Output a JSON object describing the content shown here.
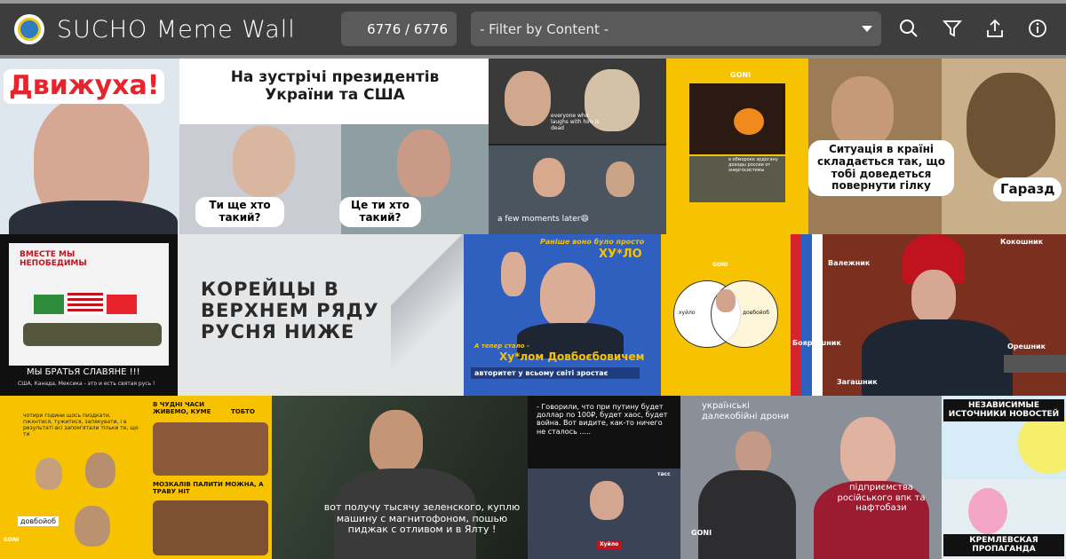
{
  "app": {
    "title": "SUCHO Meme Wall",
    "counter": "6776 / 6776",
    "filter_placeholder": "- Filter by Content -"
  },
  "icons": [
    "logo-icon",
    "search-icon",
    "filter-icon",
    "share-icon",
    "info-icon"
  ],
  "colors": {
    "header": "#3d3d3d",
    "yellow": "#f7c200",
    "blue": "#2f5fbf",
    "red": "#e8232c"
  },
  "memes": {
    "m1": {
      "caption": "Движуха!"
    },
    "m2": {
      "headline": "На зустрічі президентів України та США",
      "left_bubble": "Ти ще хто такий?",
      "right_bubble": "Це ти хто такий?"
    },
    "m3": {
      "top_caption": "everyone who laughs with him is dead",
      "bottom_caption": "a few moments later😄"
    },
    "m4": {
      "logo": "GONI",
      "caption": "в обмороке эрдогану доходы россии от энергосистемы"
    },
    "m5": {
      "speech_left": "Ситуація в країні складається так, що тобі доведеться повернути гілку",
      "speech_right": "Гаразд"
    },
    "m6": {
      "title": "ВМЕСТЕ МЫ НЕПОБЕДИМЫ",
      "caption": "МЫ БРАТЬЯ СЛАВЯНЕ !!!",
      "subcaption": "США, Канада, Мексика - это и есть святая русь !"
    },
    "m7": {
      "snow_text": "КОРЕЙЦЫ В ВЕРХНЕМ РЯДУ РУСНЯ НИЖЕ"
    },
    "m8": {
      "top": "Раніше воно було просто",
      "name": "ХУ*ЛО",
      "middle": "А тепер стало -",
      "full": "Ху*лом Довбоєбовичем",
      "bottom": "авторитет у всьому світі зростає"
    },
    "m9": {
      "logo": "GONI",
      "left": "хуйло",
      "right": "довбойоб"
    },
    "m10": {
      "labels": [
        "Кокошник",
        "Валежник",
        "Боярышник",
        "Загашник",
        "Орешник"
      ]
    },
    "m11": {
      "text": "чотири години щось пиздкати, пжхнтися, тужитися, запякувати, і в результаті всі запом'ятали тільки те, що ти",
      "label": "довбойоб",
      "logo": "GONI"
    },
    "m12": {
      "top_left": "В ЧУДНІ ЧАСИ ЖИВЕМО, КУМЕ",
      "top_right": "ТОБТО",
      "bottom": "МОЗКАЛІВ ПАЛИТИ МОЖНА, А ТРАВУ НІТ"
    },
    "m13": {
      "subtitle": "вот получу тысячу зеленского, куплю машину с магнитофоном, пошью пиджак с отливом и в Ялту !"
    },
    "m14": {
      "text": "- Говорили, что при путину будет доллар по 100₽, будет хаос, будет война. Вот видите, как-то ничего не сталось .....",
      "badge": "Хуйло",
      "tass": "тасс"
    },
    "m15": {
      "top": "українські далекобійні дрони",
      "bottom": "підприємства російського впк та нафтобази",
      "logo": "GONI"
    },
    "m16": {
      "top": "НЕЗАВИСИМЫЕ ИСТОЧНИКИ НОВОСТЕЙ",
      "bottom": "КРЕМЛЕВСКАЯ ПРОПАГАНДА"
    }
  }
}
